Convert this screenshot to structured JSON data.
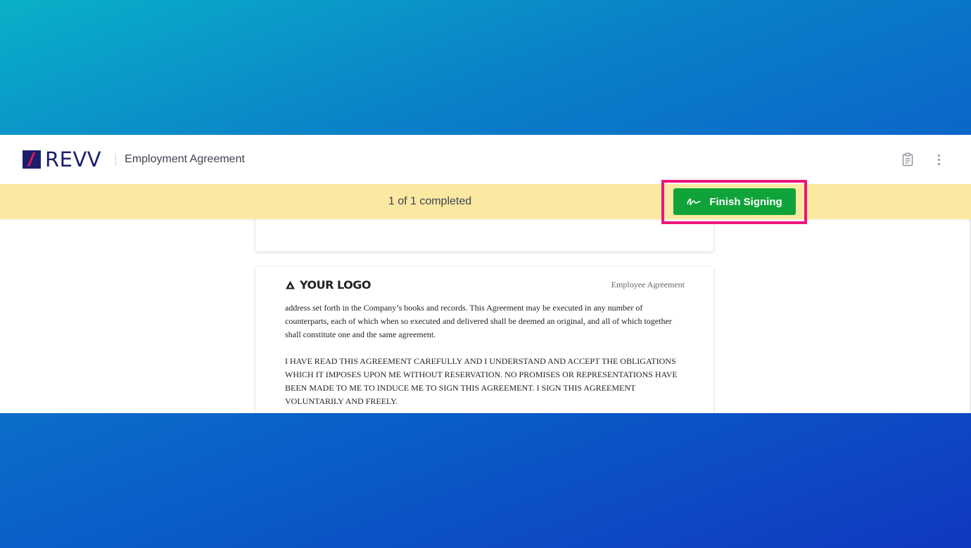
{
  "app": {
    "brand": "REVV",
    "document_title": "Employment Agreement"
  },
  "toolbar": {
    "icons": [
      "clipboard-icon",
      "more-vertical-icon"
    ]
  },
  "status": {
    "progress_text": "1 of 1 completed",
    "finish_label": "Finish Signing",
    "highlight_color": "#f0147b",
    "button_color": "#10a33a",
    "bar_color": "#fbe9a2"
  },
  "page": {
    "logo_text": "YOUR LOGO",
    "header_label": "Employee Agreement",
    "paragraphs": [
      "address set forth in the Company’s books and records. This Agreement may be executed in any number of counterparts, each of which when so executed and delivered shall be deemed an original, and all of which together shall constitute one and the same agreement.",
      "I HAVE READ THIS AGREEMENT CAREFULLY AND I UNDERSTAND AND ACCEPT THE OBLIGATIONS WHICH IT IMPOSES UPON ME WITHOUT RESERVATION. NO PROMISES OR REPRESENTATIONS HAVE BEEN MADE TO ME TO INDUCE ME TO SIGN THIS AGREEMENT. I SIGN THIS AGREEMENT VOLUNTARILY AND FREELY."
    ]
  }
}
